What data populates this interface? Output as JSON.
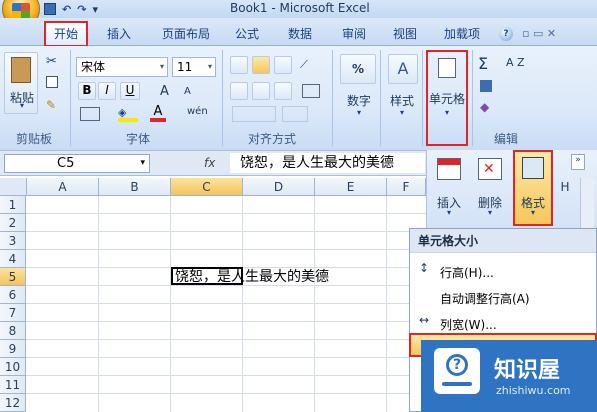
{
  "window": {
    "title": "Book1 - Microsoft Excel"
  },
  "quick_access": {
    "undo": "↶",
    "redo": "↷",
    "customize": "▾"
  },
  "tabs": [
    {
      "label": "开始",
      "active": true
    },
    {
      "label": "插入"
    },
    {
      "label": "页面布局"
    },
    {
      "label": "公式"
    },
    {
      "label": "数据"
    },
    {
      "label": "审阅"
    },
    {
      "label": "视图"
    },
    {
      "label": "加载项"
    }
  ],
  "ribbon": {
    "clipboard": {
      "paste_label": "粘贴",
      "group_label": "剪贴板"
    },
    "font": {
      "name": "宋体",
      "size": "11",
      "bold": "B",
      "italic": "I",
      "underline": "U",
      "grow": "A",
      "shrink": "A",
      "color_btn": "A",
      "phonetic": "wén",
      "group_label": "字体"
    },
    "alignment": {
      "group_label": "对齐方式"
    },
    "number": {
      "percent": "%",
      "label": "数字"
    },
    "styles": {
      "label": "样式"
    },
    "cells": {
      "label": "单元格"
    },
    "editing": {
      "sigma": "Σ",
      "sort": "A Z",
      "group_label": "编辑"
    }
  },
  "formula_bar": {
    "name_box": "C5",
    "fx": "fx",
    "value": "饶恕，是人生最大的美德"
  },
  "grid": {
    "columns": [
      "A",
      "B",
      "C",
      "D",
      "E",
      "F"
    ],
    "rows": [
      "1",
      "2",
      "3",
      "4",
      "5",
      "6",
      "7",
      "8",
      "9",
      "10",
      "11",
      "12"
    ],
    "selected_col": "C",
    "selected_row": "5",
    "cell_c5_text": "饶恕，是人生最大的美德"
  },
  "cells_panel": {
    "insert_label": "插入",
    "delete_label": "删除",
    "format_label": "格式",
    "h_col": "H"
  },
  "dropdown": {
    "header": "单元格大小",
    "items": [
      {
        "label": "行高(H)..."
      },
      {
        "label": "自动调整行高(A)"
      },
      {
        "label": "列宽(W)..."
      }
    ]
  },
  "watermark": {
    "title": "知识屋",
    "subtitle": "zhishiwu.com"
  },
  "colors": {
    "accent_red": "#e0252a",
    "ribbon_blue": "#15428b",
    "select_orange": "#f5c35a"
  }
}
